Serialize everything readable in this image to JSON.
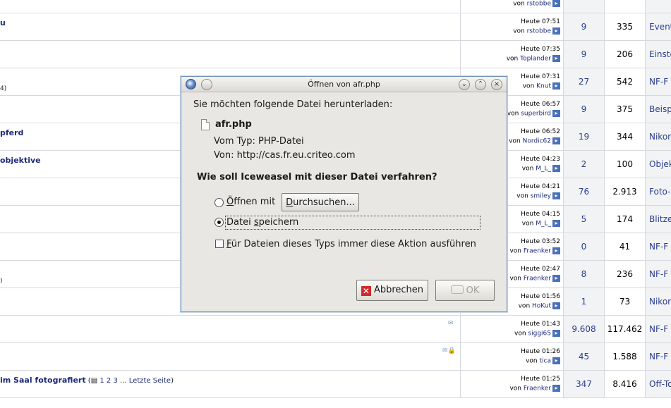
{
  "forum": {
    "rows": [
      {
        "title": "",
        "sub": "",
        "time": "",
        "user": "rstobbe",
        "replies": "",
        "views": "",
        "forum": ""
      },
      {
        "title": "u",
        "sub": "",
        "time": "Heute 07:51",
        "user": "rstobbe",
        "replies": "9",
        "views": "335",
        "forum": "Event"
      },
      {
        "title": "",
        "sub": "",
        "time": "Heute 07:35",
        "user": "Toplander",
        "replies": "9",
        "views": "206",
        "forum": "Einste"
      },
      {
        "title": "",
        "sub": "4)",
        "time": "Heute 07:31",
        "user": "Knut",
        "replies": "27",
        "views": "542",
        "forum": "NF-F"
      },
      {
        "title": "",
        "sub": "",
        "time": "Heute 06:57",
        "user": "superbird",
        "replies": "9",
        "views": "375",
        "forum": "Beisp"
      },
      {
        "title": "pferd",
        "sub": "",
        "time": "Heute 06:52",
        "user": "Nordic62",
        "replies": "19",
        "views": "344",
        "forum": "Nikon"
      },
      {
        "title": "objektive",
        "sub": "",
        "time": "Heute 04:23",
        "user": "M_L_",
        "replies": "2",
        "views": "100",
        "forum": "Objek"
      },
      {
        "title": "",
        "sub": "",
        "time": "Heute 04:21",
        "user": "smiley",
        "replies": "76",
        "views": "2.913",
        "forum": "Foto-F"
      },
      {
        "title": "",
        "sub": "",
        "time": "Heute 04:15",
        "user": "M_L_",
        "replies": "5",
        "views": "174",
        "forum": "Blitzer"
      },
      {
        "title": "",
        "sub": "",
        "time": "Heute 03:52",
        "user": "Fraenker",
        "replies": "0",
        "views": "41",
        "forum": "NF-F"
      },
      {
        "title": "",
        "sub": ")",
        "time": "Heute 02:47",
        "user": "Fraenker",
        "replies": "8",
        "views": "236",
        "forum": "NF-F"
      },
      {
        "title": "",
        "sub": "",
        "time": "Heute 01:56",
        "user": "HoKut",
        "replies": "1",
        "views": "73",
        "forum": "Nikon"
      },
      {
        "title": "",
        "sub": "",
        "time": "Heute 01:43",
        "user": "siggi65",
        "replies": "9.608",
        "views": "117.462",
        "forum": "NF-F"
      },
      {
        "title": "",
        "sub": "",
        "time": "Heute 01:26",
        "user": "tica",
        "replies": "45",
        "views": "1.588",
        "forum": "NF-F"
      },
      {
        "title": "im Saal fotografiert",
        "sub": "",
        "time": "Heute 01:25",
        "user": "Fraenker",
        "replies": "347",
        "views": "8.416",
        "forum": "Off-To"
      }
    ],
    "last_row_pages": {
      "open": "(",
      "pages": [
        "1",
        "2",
        "3"
      ],
      "ellipsis": "...",
      "last": "Letzte Seite",
      "close": ")"
    },
    "von_label": "von"
  },
  "dialog": {
    "title": "Öffnen von afr.php",
    "intro": "Sie möchten folgende Datei herunterladen:",
    "filename": "afr.php",
    "type_line": "Vom Typ: PHP-Datei",
    "from_line": "Von: http://cas.fr.eu.criteo.com",
    "question": "Wie soll Iceweasel mit dieser Datei verfahren?",
    "open_with_first": "Ö",
    "open_with_rest": "ffnen mit",
    "browse_first": "D",
    "browse_rest": "urchsuchen...",
    "save_pre": "Datei ",
    "save_key": "s",
    "save_post": "peichern",
    "always_first": "F",
    "always_rest": "ür Dateien dieses Typs immer diese Aktion ausführen",
    "cancel_label": "Abbrechen",
    "ok_label": "OK",
    "selected_option": "save",
    "always_checked": false
  }
}
